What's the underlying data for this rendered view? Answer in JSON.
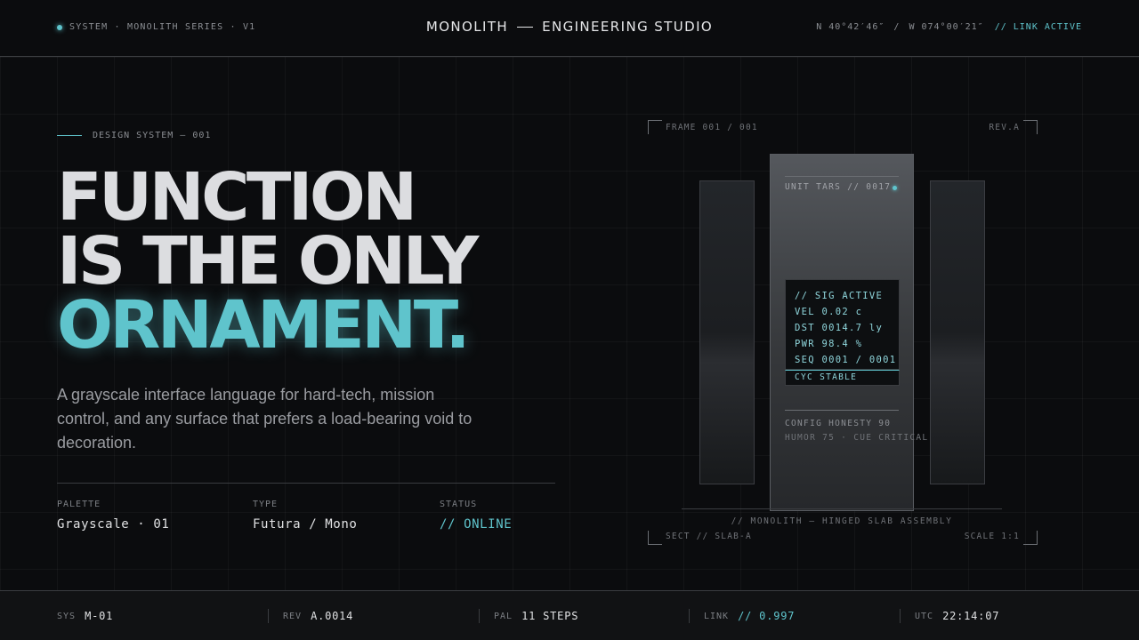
{
  "header": {
    "system_label": "SYSTEM · MONOLITH SERIES · V1",
    "brand_left": "MONOLITH",
    "brand_right": "ENGINEERING STUDIO",
    "lat": "N 40°42′46″",
    "coord_sep": "/",
    "lon": "W 074°00′21″",
    "link_status": "// LINK ACTIVE"
  },
  "hero": {
    "eyebrow": "DESIGN SYSTEM — 001",
    "headline_1": "FUNCTION",
    "headline_2": "IS THE ONLY",
    "headline_3": "ORNAMENT.",
    "lede": "A grayscale interface language for hard-tech, mission control, and any surface that prefers a load-bearing void to decoration."
  },
  "meta": [
    {
      "key": "PALETTE",
      "value": "Grayscale · 01"
    },
    {
      "key": "TYPE",
      "value": "Futura / Mono"
    },
    {
      "key": "STATUS",
      "value": "// ONLINE"
    }
  ],
  "illustration": {
    "frame_label": "FRAME 001 / 001",
    "rev_label": "REV.A",
    "sect_label": "SECT // SLAB-A",
    "scale_label": "SCALE 1:1",
    "unit_label": "UNIT TARS // 0017",
    "readout": [
      "// SIG ACTIVE",
      "VEL 0.02 c",
      "DST 0014.7 ly",
      "PWR 98.4 %",
      "SEQ 0001 / 0001"
    ],
    "cycle": "CYC STABLE",
    "config_1": "CONFIG HONESTY 90",
    "config_2": "HUMOR 75 · CUE CRITICAL",
    "caption": "// MONOLITH — HINGED SLAB ASSEMBLY"
  },
  "footer": [
    {
      "key": "SYS",
      "value": "M-01"
    },
    {
      "key": "REV",
      "value": "A.0014"
    },
    {
      "key": "PAL",
      "value": "11 STEPS"
    },
    {
      "key": "LINK",
      "value": "// 0.997"
    },
    {
      "key": "UTC",
      "value": "22:14:07"
    }
  ],
  "colors": {
    "background": "#0b0c0e",
    "accent": "#5fc4cc",
    "text": "#dcdde0",
    "muted": "#8b8e93"
  }
}
